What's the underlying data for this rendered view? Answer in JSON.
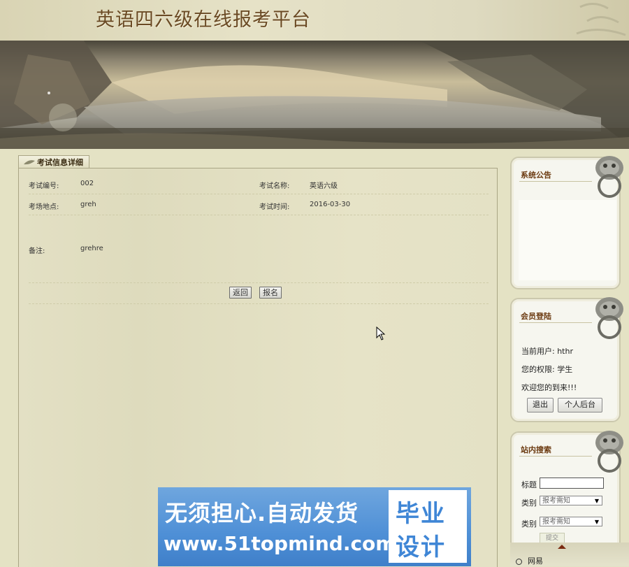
{
  "header": {
    "title": "英语四六级在线报考平台"
  },
  "detail": {
    "tab_label": "考试信息详细",
    "exam_no_label": "考试编号:",
    "exam_no_value": "002",
    "exam_name_label": "考试名称:",
    "exam_name_value": "英语六级",
    "location_label": "考场地点:",
    "location_value": "greh",
    "time_label": "考试时间:",
    "time_value": "2016-03-30",
    "note_label": "备注:",
    "note_value": "grehre",
    "back_button": "返回",
    "signup_button": "报名"
  },
  "announcement": {
    "title": "系统公告"
  },
  "member": {
    "title": "会员登陆",
    "current_user": "当前用户: hthr",
    "permission": "您的权限: 学生",
    "welcome": "欢迎您的到来!!!",
    "logout_button": "退出",
    "backend_button": "个人后台"
  },
  "search": {
    "title": "站内搜索",
    "title_label": "标题",
    "category_label_1": "类别",
    "category_select_1": "报考需知",
    "category_label_2": "类别",
    "category_select_2": "报考需知",
    "submit_button": "提交"
  },
  "links": {
    "first_link": "网易"
  },
  "ad": {
    "line1": "无须担心.自动发货",
    "line2": "www.51topmind.com",
    "right_top": "毕业",
    "right_bottom": "设计"
  },
  "colors": {
    "title": "#6a4a24",
    "side_title": "#6b3a10",
    "ad_blue": "#4e8fd6"
  }
}
